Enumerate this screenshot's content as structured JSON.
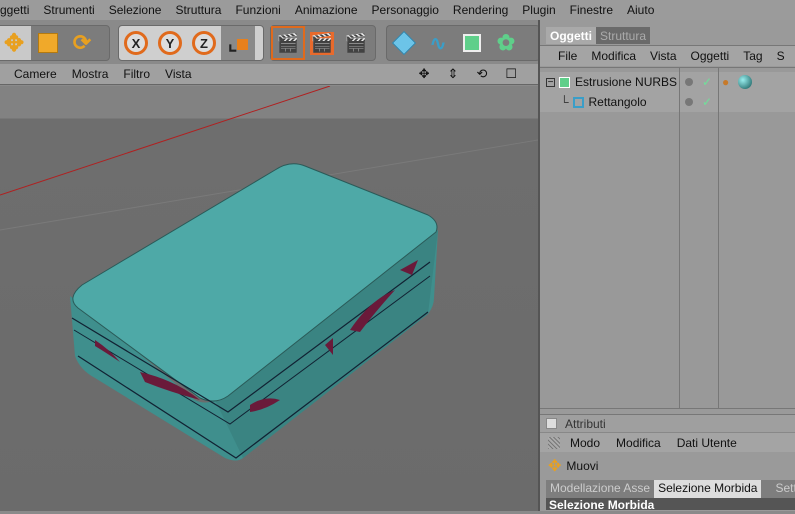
{
  "menubar": {
    "items": [
      "ggetti",
      "Strumenti",
      "Selezione",
      "Struttura",
      "Funzioni",
      "Animazione",
      "Personaggio",
      "Rendering",
      "Plugin",
      "Finestre",
      "Aiuto"
    ]
  },
  "toolbar": {
    "axis_x": "X",
    "axis_y": "Y",
    "axis_z": "Z"
  },
  "viewport": {
    "menu": [
      "Camere",
      "Mostra",
      "Filtro",
      "Vista"
    ],
    "icons": [
      "move-view-icon",
      "dolly-icon",
      "rotate-view-icon",
      "maximize-icon"
    ],
    "object_color": "#4ea9a7"
  },
  "objects_panel": {
    "tabs": [
      "Oggetti",
      "Struttura"
    ],
    "menu": [
      "File",
      "Modifica",
      "Vista",
      "Oggetti",
      "Tag",
      "S"
    ],
    "items": [
      {
        "name": "Estrusione NURBS"
      },
      {
        "name": "Rettangolo"
      }
    ]
  },
  "attributes_panel": {
    "title": "Attributi",
    "menu": [
      "Modo",
      "Modifica",
      "Dati Utente"
    ],
    "tool": "Muovi",
    "tabs": [
      "Modellazione Asse",
      "Selezione Morbida",
      "Sett"
    ],
    "section": "Selezione Morbida"
  }
}
